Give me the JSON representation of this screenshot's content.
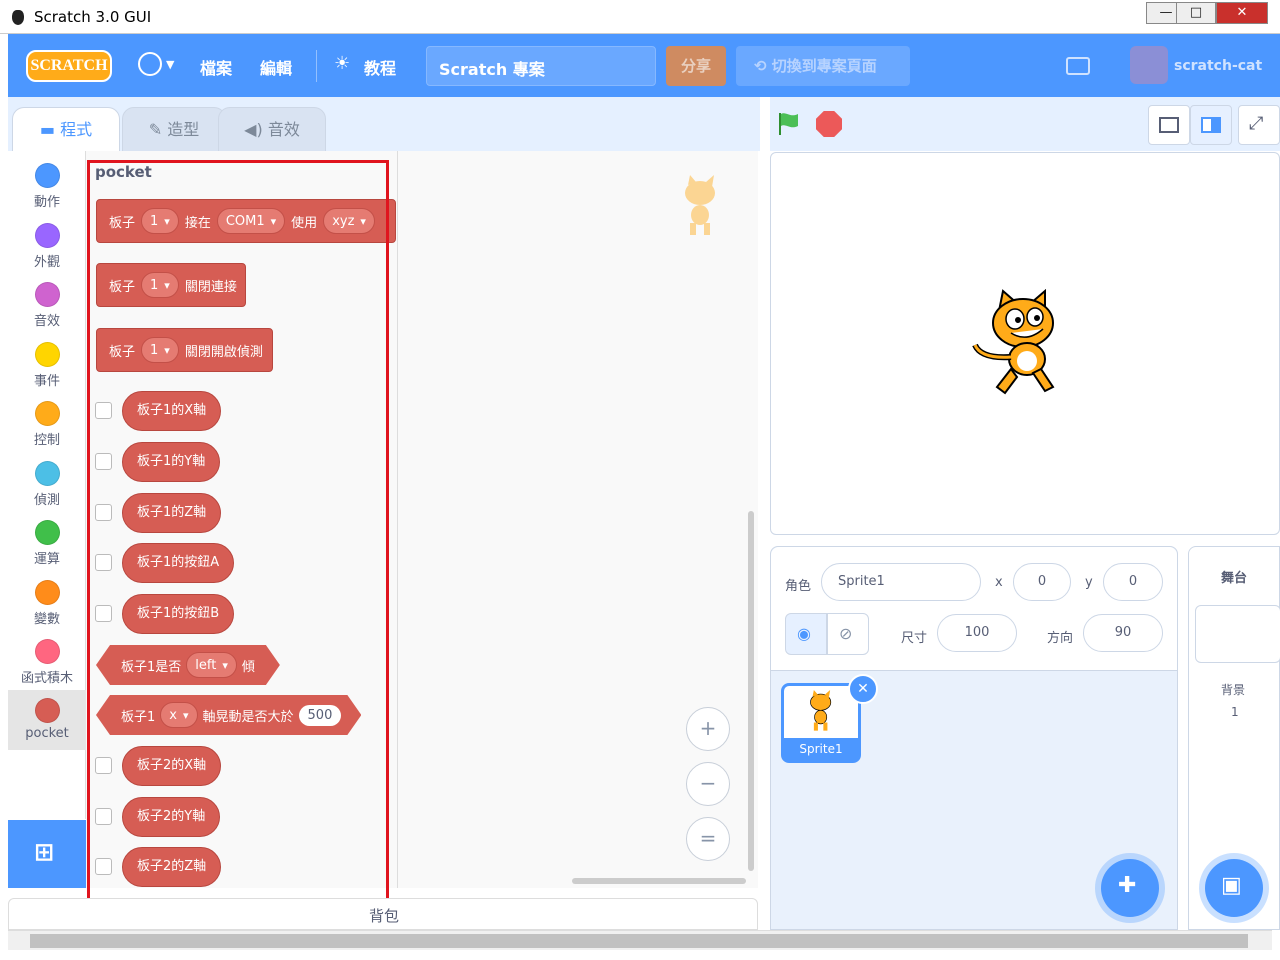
{
  "window": {
    "title": "Scratch 3.0 GUI"
  },
  "menu": {
    "logo": "SCRATCH",
    "file": "檔案",
    "edit": "編輯",
    "tutorials": "教程",
    "project_title": "Scratch 專案",
    "share": "分享",
    "see_project": "切換到專案頁面",
    "username": "scratch-cat"
  },
  "tabs": {
    "code": "程式",
    "costumes": "造型",
    "sounds": "音效"
  },
  "categories": [
    {
      "label": "動作",
      "color": "#4c97ff"
    },
    {
      "label": "外觀",
      "color": "#9966ff"
    },
    {
      "label": "音效",
      "color": "#cf63cf"
    },
    {
      "label": "事件",
      "color": "#ffd500"
    },
    {
      "label": "控制",
      "color": "#ffab19"
    },
    {
      "label": "偵測",
      "color": "#4cbfe6"
    },
    {
      "label": "運算",
      "color": "#40bf4a"
    },
    {
      "label": "變數",
      "color": "#ff8c1a"
    },
    {
      "label": "函式積木",
      "color": "#ff6680"
    },
    {
      "label": "pocket",
      "color": "#d65d54"
    }
  ],
  "palette": {
    "title": "pocket",
    "b1": {
      "t1": "板子",
      "v1": "1",
      "t2": "接在",
      "v2": "COM1",
      "t3": "使用",
      "v3": "xyz"
    },
    "b2": {
      "t1": "板子",
      "v1": "1",
      "t2": "關閉連接"
    },
    "b3": {
      "t1": "板子",
      "v1": "1",
      "t2": "關閉開啟偵測"
    },
    "reporters": [
      "板子1的X軸",
      "板子1的Y軸",
      "板子1的Z軸",
      "板子1的按鈕A",
      "板子1的按鈕B"
    ],
    "h1": {
      "t1": "板子1是否",
      "v1": "left",
      "t2": "傾"
    },
    "h2": {
      "t1": "板子1",
      "v1": "x",
      "t2": "軸晃動是否大於",
      "v2": "500"
    },
    "reporters2": [
      "板子2的X軸",
      "板子2的Y軸",
      "板子2的Z軸"
    ]
  },
  "workspace": {
    "zoom_in": "+",
    "zoom_out": "−",
    "zoom_reset": "="
  },
  "backpack": "背包",
  "sprite": {
    "label": "角色",
    "name": "Sprite1",
    "x_label": "x",
    "x": "0",
    "y_label": "y",
    "y": "0",
    "size_label": "尺寸",
    "size": "100",
    "direction_label": "方向",
    "direction": "90",
    "thumb_name": "Sprite1"
  },
  "stage_panel": {
    "title": "舞台",
    "backdrops_label": "背景",
    "backdrops_count": "1"
  },
  "colors": {
    "accent": "#4c97ff",
    "pocket": "#d65d54",
    "highlight": "#e0141e"
  }
}
